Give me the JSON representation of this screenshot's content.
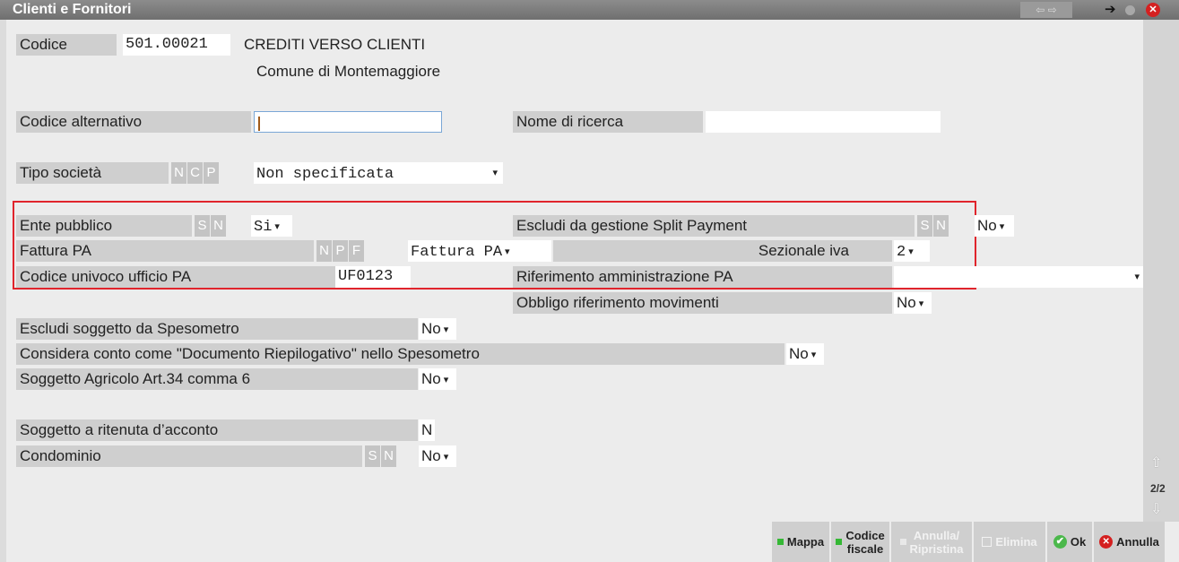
{
  "window": {
    "title": "Clienti e Fornitori",
    "nav_arrows": "⇦ ⇨",
    "pin_icon": "pin-icon",
    "close_symbol": "✕"
  },
  "header": {
    "codice_label": "Codice",
    "codice_value": "501.00021",
    "account_name": "CREDITI VERSO CLIENTI",
    "account_subname": "Comune di Montemaggiore"
  },
  "fields": {
    "codice_alternativo_label": "Codice alternativo",
    "codice_alternativo_value": "",
    "nome_ricerca_label": "Nome di ricerca",
    "nome_ricerca_value": "",
    "tipo_societa_label": "Tipo società",
    "tipo_societa_options": [
      "N",
      "C",
      "P"
    ],
    "tipo_societa_value": "Non specificata",
    "ente_pubblico_label": "Ente pubblico",
    "ente_pubblico_options": [
      "S",
      "N"
    ],
    "ente_pubblico_value": "Si",
    "split_payment_label": "Escludi da gestione Split Payment",
    "split_payment_options": [
      "S",
      "N"
    ],
    "split_payment_value": "No",
    "fattura_pa_label": "Fattura PA",
    "fattura_pa_options": [
      "N",
      "P",
      "F"
    ],
    "fattura_pa_value": "Fattura PA",
    "sezionale_iva_label": "Sezionale iva",
    "sezionale_iva_value": "2",
    "codice_univoco_label": "Codice univoco ufficio PA",
    "codice_univoco_value": "UF0123",
    "riferimento_amm_label": "Riferimento amministrazione PA",
    "riferimento_amm_value": "",
    "obbligo_rif_label": "Obbligo riferimento movimenti",
    "obbligo_rif_value": "No",
    "escludi_spesometro_label": "Escludi soggetto da Spesometro",
    "escludi_spesometro_value": "No",
    "doc_riepilogativo_label": "Considera conto come \"Documento Riepilogativo\" nello Spesometro",
    "doc_riepilogativo_value": "No",
    "soggetto_agricolo_label": "Soggetto Agricolo Art.34 comma 6",
    "soggetto_agricolo_value": "No",
    "ritenuta_label": "Soggetto a ritenuta d’acconto",
    "ritenuta_value": "N",
    "condominio_label": "Condominio",
    "condominio_options": [
      "S",
      "N"
    ],
    "condominio_value": "No"
  },
  "scroll": {
    "page_indicator": "2/2"
  },
  "buttons": {
    "mappa": "Mappa",
    "codice_fiscale_1": "Codice",
    "codice_fiscale_2": "fiscale",
    "annulla_ripristina_1": "Annulla/",
    "annulla_ripristina_2": "Ripristina",
    "elimina": "Elimina",
    "ok": "Ok",
    "annulla": "Annulla"
  },
  "colors": {
    "highlight_box": "#e0242c",
    "title_bar": "#7a7a7a",
    "button_green": "#35b835",
    "close_red": "#d42020"
  }
}
